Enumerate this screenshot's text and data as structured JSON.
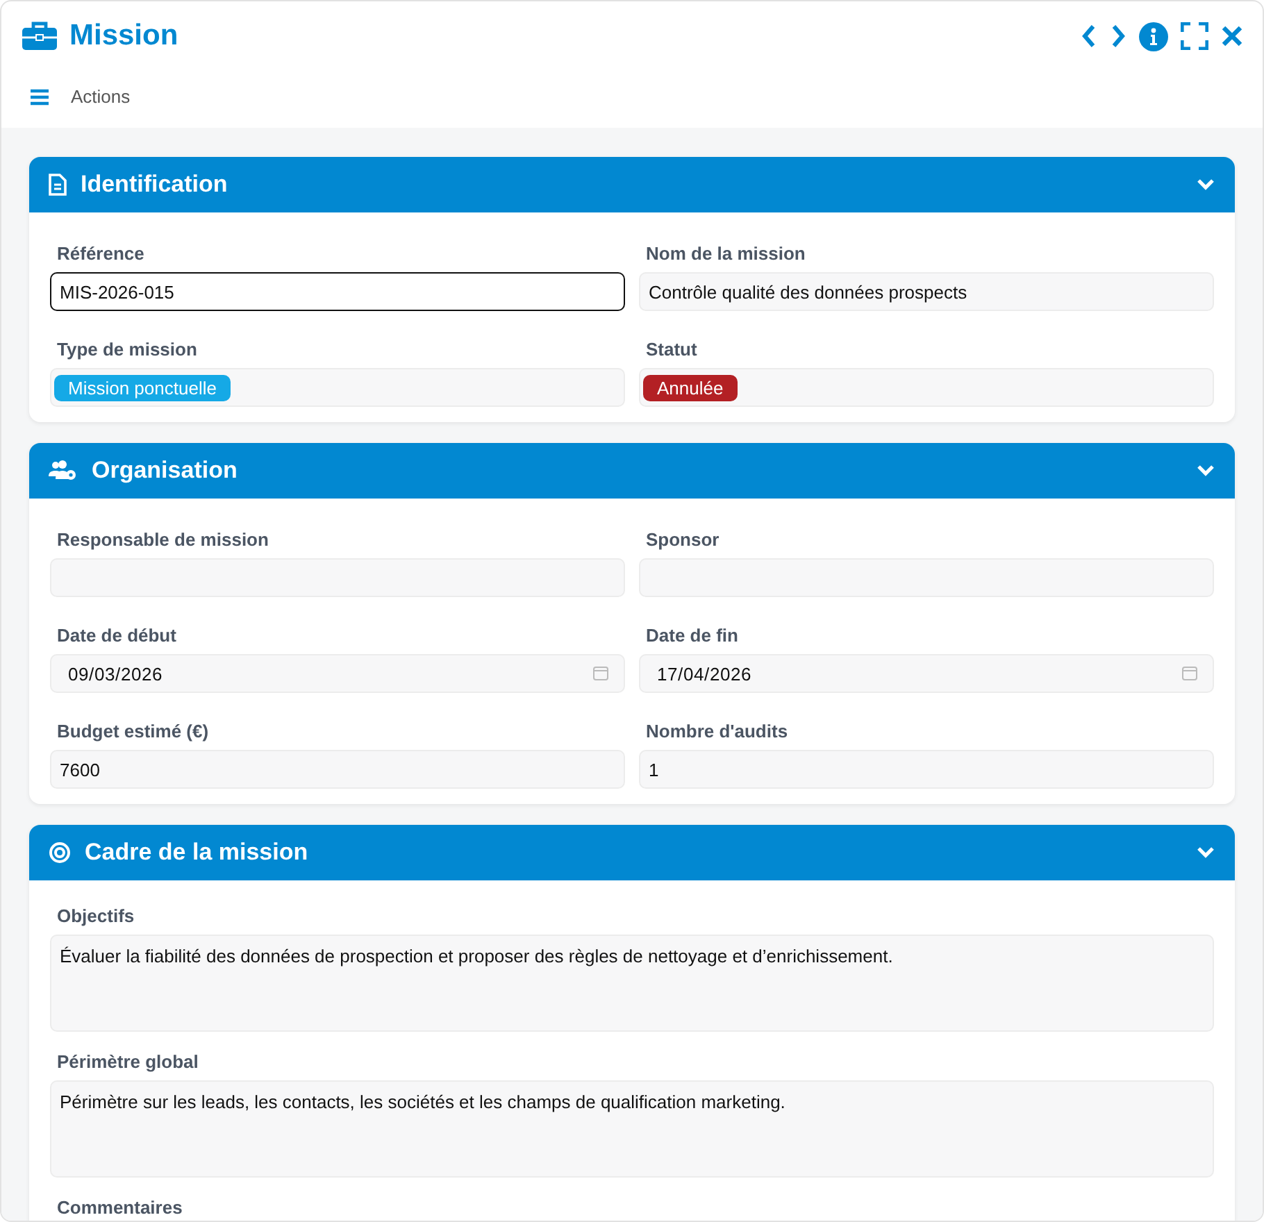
{
  "window": {
    "title": "Mission"
  },
  "toolbar": {
    "label": "Actions"
  },
  "sections": [
    {
      "title": "Identification",
      "expanded": true,
      "fields": [
        {
          "label": "Référence",
          "kind": "text",
          "value": "MIS-2026-015",
          "focused": true
        },
        {
          "label": "Nom de la mission",
          "kind": "text",
          "value": "Contrôle qualité des données prospects",
          "focused": false
        },
        {
          "label": "Type de mission",
          "kind": "tag",
          "value": "Mission ponctuelle",
          "color": "#15a9e6"
        },
        {
          "label": "Statut",
          "kind": "tag",
          "value": "Annulée",
          "color": "#b32024"
        }
      ]
    },
    {
      "title": "Organisation",
      "expanded": true,
      "fields": [
        {
          "label": "Responsable de mission",
          "kind": "text",
          "focused": false
        },
        {
          "label": "Sponsor",
          "kind": "text",
          "focused": false
        },
        {
          "label": "Date de début",
          "kind": "date",
          "value": "09/03/2026"
        },
        {
          "label": "Date de fin",
          "kind": "date",
          "value": "17/04/2026"
        },
        {
          "label": "Budget estimé (€)",
          "kind": "text",
          "value": "7600",
          "focused": false
        },
        {
          "label": "Nombre d'audits",
          "kind": "text",
          "value": "1",
          "focused": false
        }
      ]
    },
    {
      "title": "Cadre de la mission",
      "expanded": true,
      "fields": [
        {
          "label": "Objectifs",
          "kind": "textarea",
          "value": "Évaluer la fiabilité des données de prospection et proposer des règles de nettoyage et d’enrichissement."
        },
        {
          "label": "Périmètre global",
          "kind": "textarea",
          "value": "Périmètre sur les leads, les contacts, les sociétés et les champs de qualification marketing."
        },
        {
          "label": "Commentaires",
          "kind": "label"
        }
      ]
    }
  ]
}
